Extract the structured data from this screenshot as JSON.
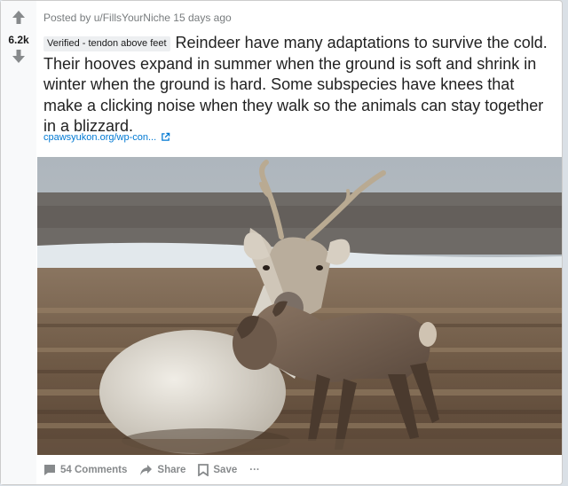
{
  "post": {
    "score": "6.2k",
    "posted_by": "Posted by u/FillsYourNiche 15 days ago",
    "flair": "Verified - tendon above feet",
    "title": "Reindeer have many adaptations to survive the cold. Their hooves expand in summer when the ground is soft and shrink in winter when the ground is hard. Some subspecies have knees that make a clicking noise when they walk so the animals can stay together in a blizzard.",
    "link_text": "cpawsyukon.org/wp-con..."
  },
  "actions": {
    "comments": "54 Comments",
    "share": "Share",
    "save": "Save",
    "more": "···"
  },
  "icons": [
    "upvote-icon",
    "downvote-icon",
    "external-link-icon",
    "comment-icon",
    "share-icon",
    "save-icon",
    "more-icon"
  ],
  "colors": {
    "link": "#0079d3",
    "meta": "#787c7e",
    "vote": "#878a8c"
  }
}
